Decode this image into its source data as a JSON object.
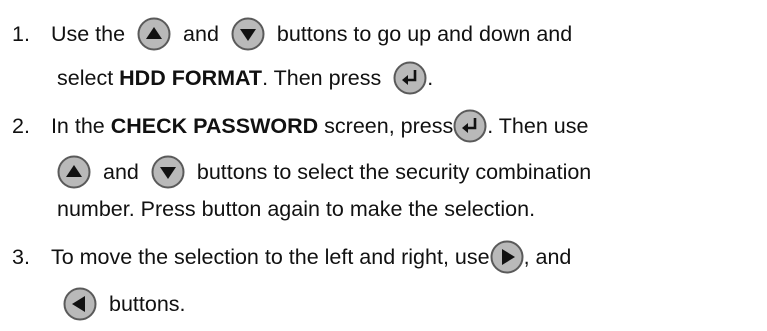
{
  "steps": [
    {
      "number": "1.",
      "t1": "Use the",
      "t2": "and",
      "t3": "buttons to go up and down and",
      "t4": "select",
      "bold1": "HDD FORMAT",
      "t5": ". Then press",
      "t6": "."
    },
    {
      "number": "2.",
      "t1": "In the",
      "bold1": "CHECK PASSWORD",
      "t2": "screen, press",
      "t3": ". Then use",
      "t4": "and",
      "t5": "buttons to select the security combination",
      "t6": "number. Press button again to make the selection."
    },
    {
      "number": "3.",
      "t1": "To move the selection to the left and right, use",
      "t2": ", and",
      "t3": "buttons."
    }
  ],
  "icons": {
    "up": "up-arrow-icon",
    "down": "down-arrow-icon",
    "enter": "enter-icon",
    "right": "right-arrow-icon",
    "left": "left-arrow-icon"
  },
  "colors": {
    "button_fill": "#b9b9b9",
    "button_stroke": "#5a5a5a",
    "glyph": "#111111"
  }
}
